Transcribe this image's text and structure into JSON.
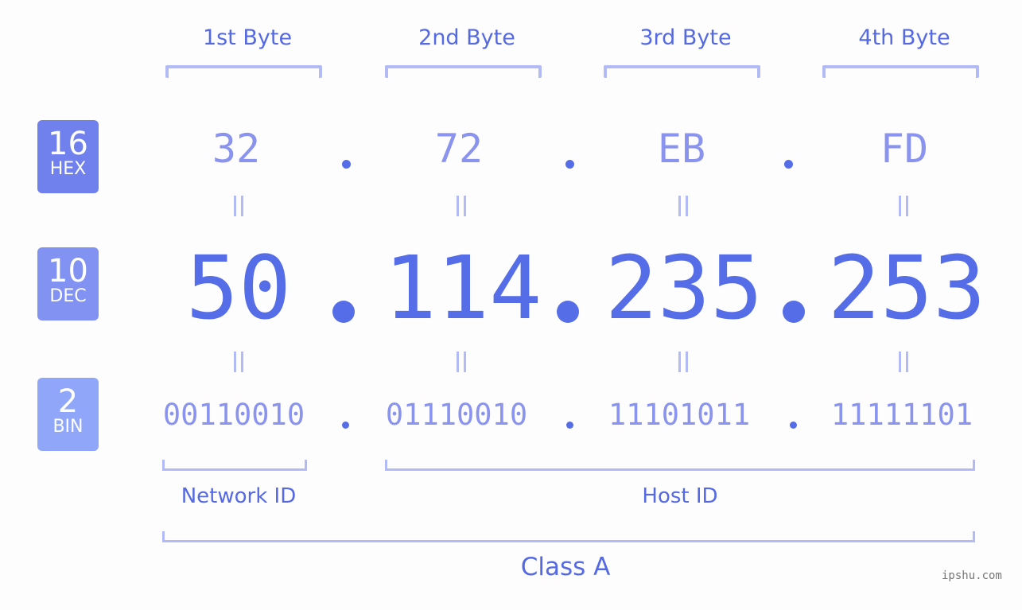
{
  "bytes": [
    {
      "label": "1st Byte",
      "hex": "32",
      "dec": "50",
      "bin": "00110010"
    },
    {
      "label": "2nd Byte",
      "hex": "72",
      "dec": "114",
      "bin": "01110010"
    },
    {
      "label": "3rd Byte",
      "hex": "EB",
      "dec": "235",
      "bin": "11101011"
    },
    {
      "label": "4th Byte",
      "hex": "FD",
      "dec": "253",
      "bin": "11111101"
    }
  ],
  "badges": {
    "hex": {
      "num": "16",
      "label": "HEX",
      "color": "#7080ec"
    },
    "dec": {
      "num": "10",
      "label": "DEC",
      "color": "#8292f2"
    },
    "bin": {
      "num": "2",
      "label": "BIN",
      "color": "#90a6f8"
    }
  },
  "equals_symbol": "=",
  "network_id_label": "Network ID",
  "host_id_label": "Host ID",
  "class_label": "Class A",
  "watermark": "ipshu.com",
  "colors": {
    "accent": "#566de8",
    "light": "#8a94ee",
    "bracket": "#b2bbf5",
    "background": "#fcfdfc"
  }
}
